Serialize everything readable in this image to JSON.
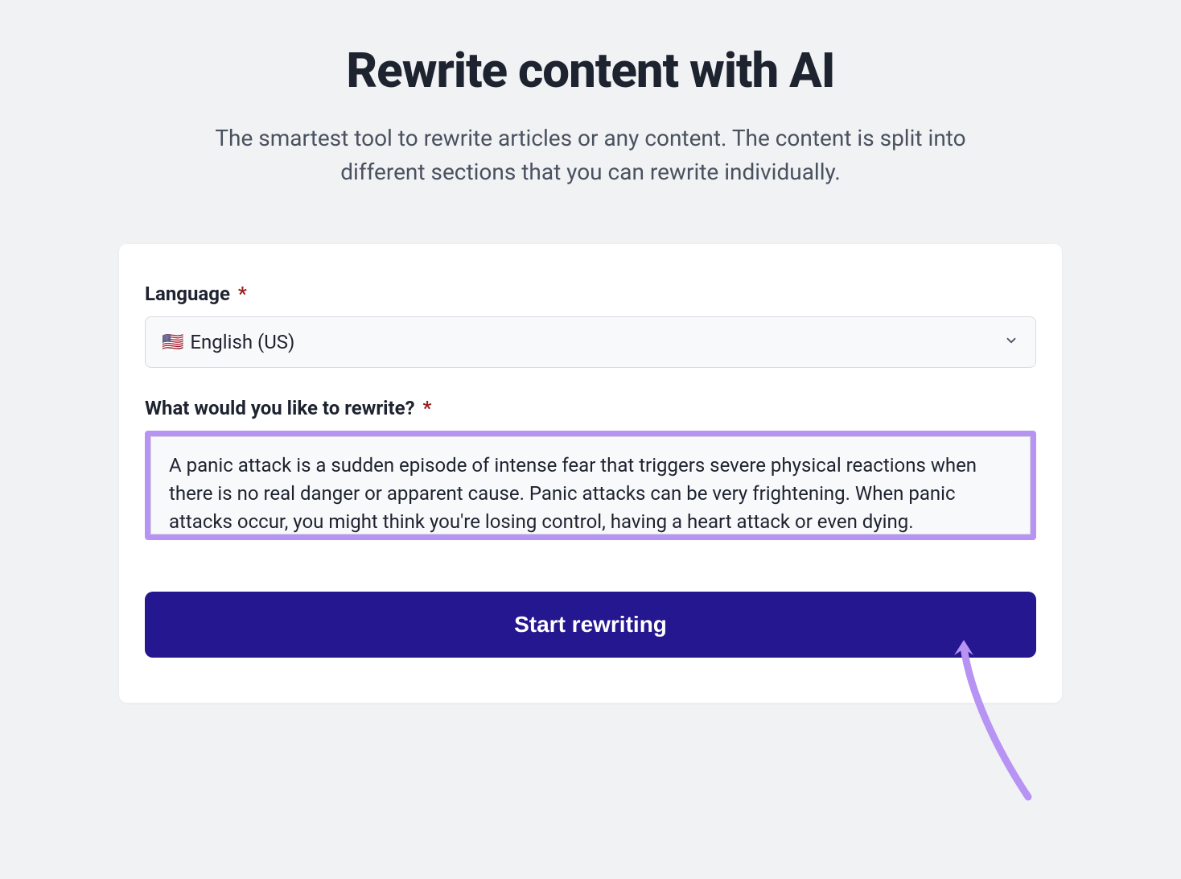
{
  "header": {
    "title": "Rewrite content with AI",
    "subtitle": "The smartest tool to rewrite articles or any content. The content is split into different sections that you can rewrite individually."
  },
  "form": {
    "language": {
      "label": "Language",
      "required": "*",
      "flag": "🇺🇸",
      "value": "English (US)"
    },
    "content": {
      "label": "What would you like to rewrite?",
      "required": "*",
      "value": "A panic attack is a sudden episode of intense fear that triggers severe physical reactions when there is no real danger or apparent cause. Panic attacks can be very frightening. When panic attacks occur, you might think you're losing control, having a heart attack or even dying."
    },
    "submit_label": "Start rewriting"
  }
}
